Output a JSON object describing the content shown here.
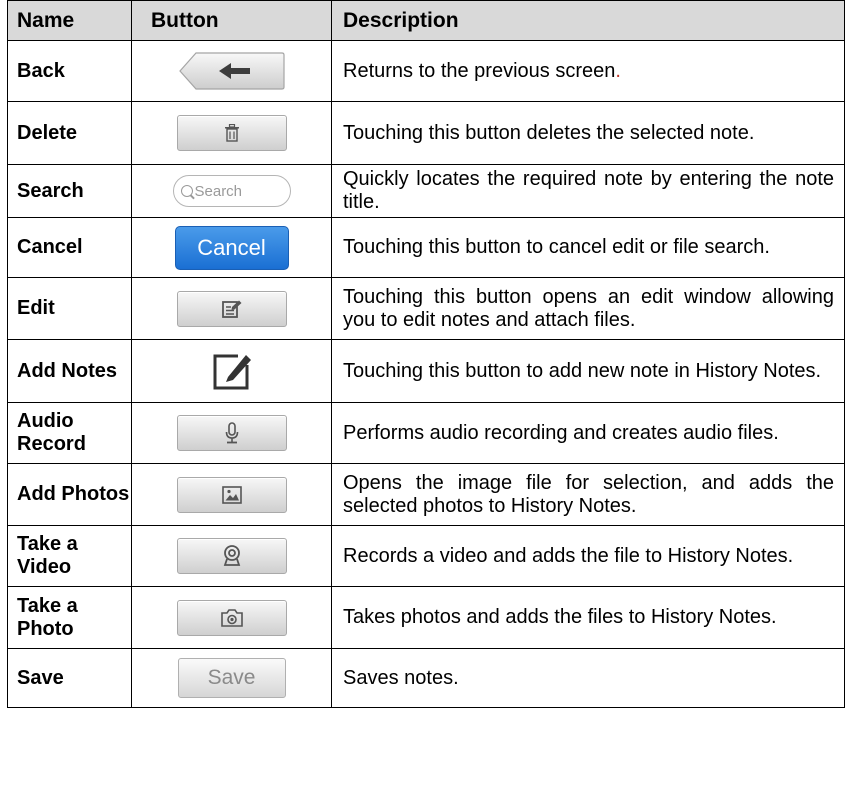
{
  "header": {
    "name": "Name",
    "button": "Button",
    "description": "Description"
  },
  "rows": [
    {
      "name": "Back",
      "icon": "back-arrow-icon",
      "description": "Returns to the previous screen",
      "trailing": "."
    },
    {
      "name": "Delete",
      "icon": "trash-icon",
      "description": "Touching this button deletes the selected note."
    },
    {
      "name": "Search",
      "icon": "search-icon",
      "button_label": "Search",
      "description": "Quickly locates the required note by entering the note title."
    },
    {
      "name": "Cancel",
      "icon": "",
      "button_label": "Cancel",
      "description": "Touching this button to cancel edit or file search."
    },
    {
      "name": "Edit",
      "icon": "edit-icon",
      "description": "Touching this button opens an edit window allowing you to edit notes and attach files."
    },
    {
      "name": "Add Notes",
      "icon": "add-note-icon",
      "description": "Touching this button to add new note in History Notes."
    },
    {
      "name": "Audio Record",
      "name_line1": "Audio",
      "name_line2": "Record",
      "icon": "microphone-icon",
      "description": "Performs audio recording and creates audio files."
    },
    {
      "name": "Add Photos",
      "icon": "image-icon",
      "description": "Opens the image file for selection, and adds the selected photos to History Notes."
    },
    {
      "name": "Take a Video",
      "icon": "webcam-icon",
      "description": "Records a video and adds the file to History Notes."
    },
    {
      "name": "Take a Photo",
      "icon": "camera-icon",
      "description": "Takes photos and adds the files to History Notes."
    },
    {
      "name": "Save",
      "icon": "",
      "button_label": "Save",
      "description": "Saves notes."
    }
  ]
}
